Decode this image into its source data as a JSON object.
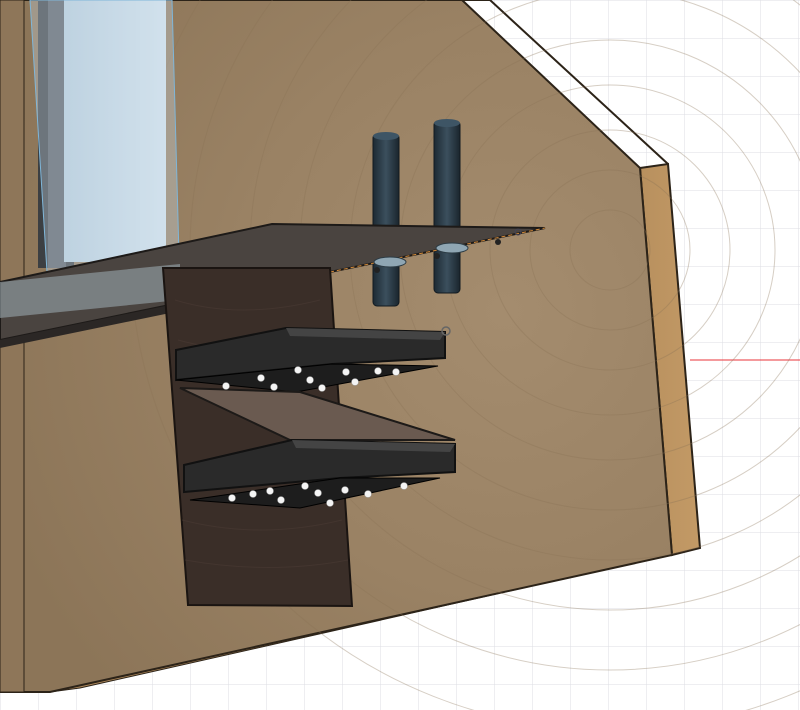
{
  "viewport": {
    "background_color": "#ffffff",
    "grid_color": "#dcdde3",
    "axis_color": "#e8333a"
  },
  "model": {
    "wall_color": "#9c8467",
    "wall_edge_color": "#b08a5c",
    "shelf_color": "#3f3a38",
    "backboard_color": "#3a2e28",
    "tray_color": "#2a2a2a",
    "tube_color": "#26333e",
    "glass_color": "#c8dbe8",
    "light_color": "#f4f4f4",
    "light_count": 20
  }
}
